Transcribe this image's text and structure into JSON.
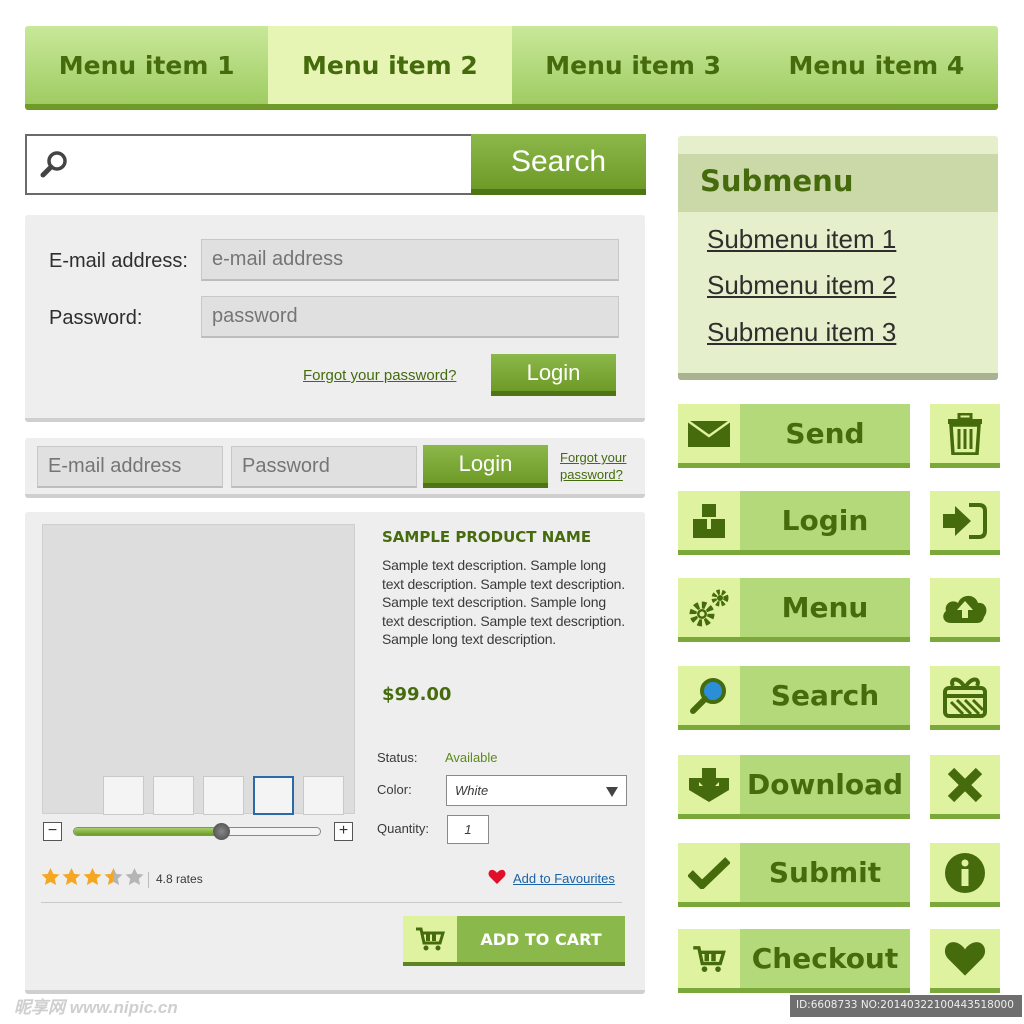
{
  "top_menu": {
    "items": [
      {
        "label": "Menu item 1",
        "active": false
      },
      {
        "label": "Menu item 2",
        "active": true
      },
      {
        "label": "Menu item 3",
        "active": false
      },
      {
        "label": "Menu item 4",
        "active": false
      }
    ]
  },
  "search": {
    "placeholder": "",
    "button_label": "Search"
  },
  "login_panel": {
    "email_label": "E-mail address:",
    "email_placeholder": "e-mail address",
    "password_label": "Password:",
    "password_placeholder": "password",
    "forgot_link": "Forgot your password?",
    "login_button": "Login"
  },
  "login_inline": {
    "email_placeholder": "E-mail address",
    "password_placeholder": "Password",
    "login_button": "Login",
    "forgot_link": "Forgot your password?"
  },
  "product": {
    "name": "SAMPLE PRODUCT NAME",
    "description": "Sample text description. Sample long text description. Sample text description. Sample text description. Sample long text description. Sample text description. Sample long text description.",
    "price": "$99.00",
    "status_label": "Status:",
    "status_value": "Available",
    "color_label": "Color:",
    "color_value": "White",
    "quantity_label": "Quantity:",
    "quantity_value": "1",
    "thumbnail_count": 5,
    "selected_thumbnail": 4,
    "zoom_level": 0.6,
    "rating_value": 3.5,
    "rating_max": 5,
    "rating_text": "4.8 rates",
    "favourites_link": "Add to Favourites",
    "add_to_cart": "ADD TO CART"
  },
  "submenu": {
    "title": "Submenu",
    "items": [
      "Submenu item 1",
      "Submenu item 2",
      "Submenu item 3"
    ]
  },
  "action_buttons": [
    {
      "label": "Send",
      "icon": "envelope-icon"
    },
    {
      "label": "Login",
      "icon": "user-icon"
    },
    {
      "label": "Menu",
      "icon": "gears-icon"
    },
    {
      "label": "Search",
      "icon": "magnifier-icon"
    },
    {
      "label": "Download",
      "icon": "download-icon"
    },
    {
      "label": "Submit",
      "icon": "checkmark-icon"
    },
    {
      "label": "Checkout",
      "icon": "cart-icon"
    }
  ],
  "square_buttons": [
    {
      "icon": "trash-icon"
    },
    {
      "icon": "sign-in-icon"
    },
    {
      "icon": "cloud-upload-icon"
    },
    {
      "icon": "gift-icon"
    },
    {
      "icon": "close-icon"
    },
    {
      "icon": "info-icon"
    },
    {
      "icon": "heart-icon"
    }
  ],
  "colors": {
    "accent_dark": "#456b0d",
    "accent": "#8bb84a",
    "accent_light": "#dff2a0",
    "link_blue": "#1a63a8",
    "star": "#f5a623"
  },
  "watermark": {
    "left": "昵享网 www.nipic.cn",
    "right": "ID:6608733 NO:20140322100443518000"
  }
}
